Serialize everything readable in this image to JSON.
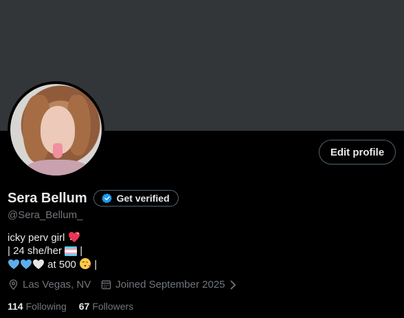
{
  "profile": {
    "name": "Sera Bellum",
    "handle": "@Sera_Bellum_",
    "edit_label": "Edit profile",
    "verify_label": "Get verified",
    "bio": {
      "line1": "icky perv girl",
      "line2_prefix": "| 24 she/her",
      "line2_suffix": "|",
      "line3_text": "at 500",
      "line3_suffix": "|"
    },
    "location": "Las Vegas, NV",
    "joined": "Joined September 2025",
    "following_count": "114",
    "following_label": "Following",
    "followers_count": "67",
    "followers_label": "Followers"
  },
  "colors": {
    "banner": "#333639",
    "background": "#000000",
    "text_primary": "#e7e9ea",
    "text_secondary": "#71767b",
    "verified_blue": "#1d9bf0"
  },
  "icons": [
    "verified-badge-icon",
    "location-icon",
    "calendar-icon",
    "chevron-right-icon"
  ]
}
